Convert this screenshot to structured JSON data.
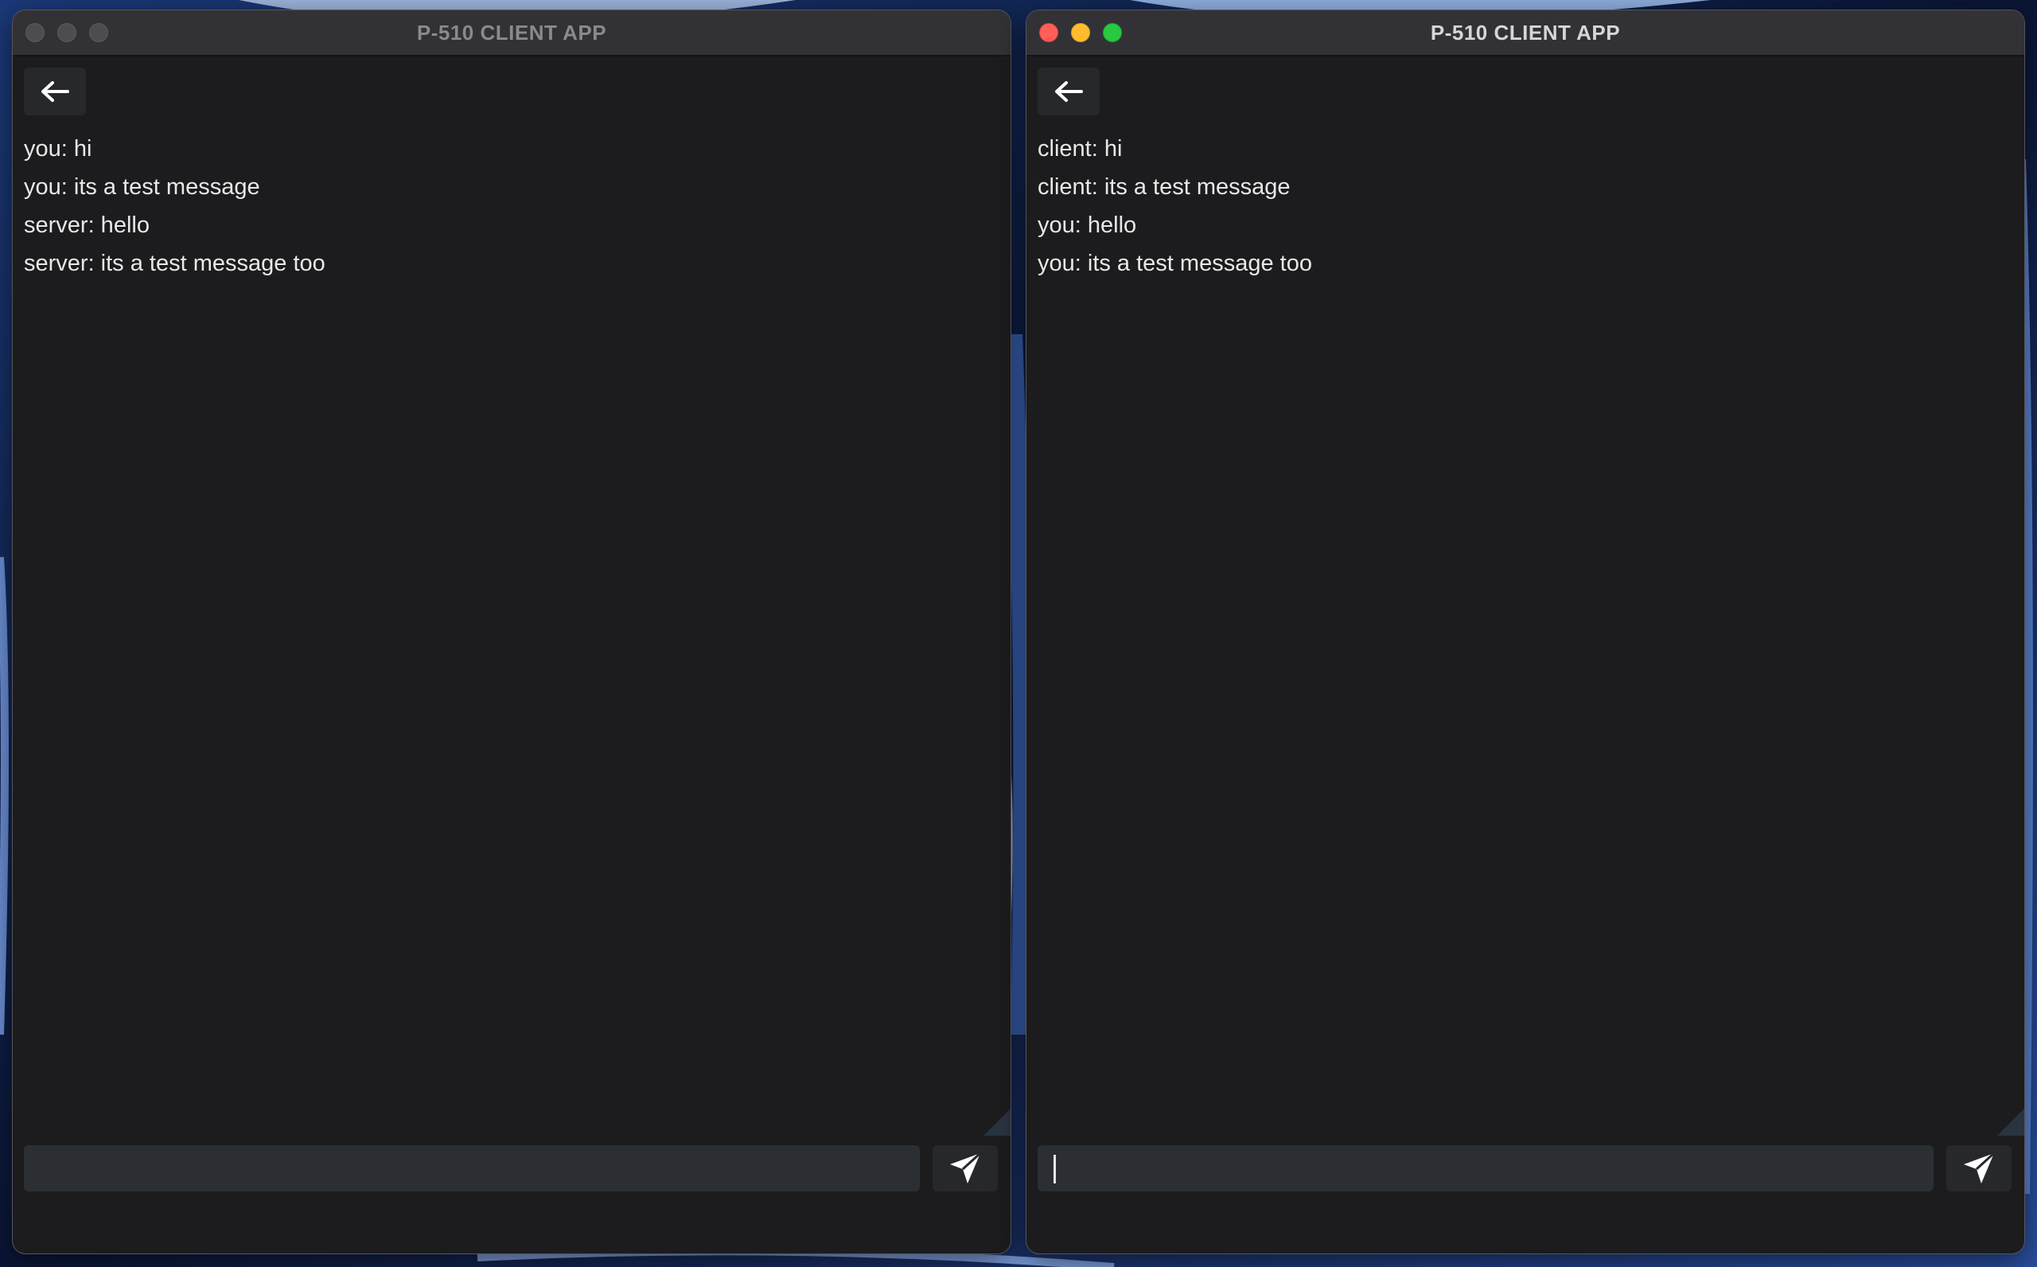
{
  "windows": [
    {
      "title": "P-510 CLIENT APP",
      "focused": false,
      "messages": [
        "you: hi",
        "you: its a test message",
        "server: hello",
        "server: its a test message too"
      ],
      "input_value": "",
      "icons": {
        "back": "arrow-left-icon",
        "send": "paper-plane-icon"
      }
    },
    {
      "title": "P-510 CLIENT APP",
      "focused": true,
      "messages": [
        "client: hi",
        "client: its a test message",
        "you: hello",
        "you: its a test message too"
      ],
      "input_value": "",
      "icons": {
        "back": "arrow-left-icon",
        "send": "paper-plane-icon"
      }
    }
  ],
  "colors": {
    "window_bg": "#1c1c1e",
    "titlebar_bg": "#323236",
    "input_bg": "#2b2f33",
    "text": "#e8e8e8",
    "close": "#ff5f57",
    "minimize": "#febc2e",
    "maximize": "#28c840"
  }
}
